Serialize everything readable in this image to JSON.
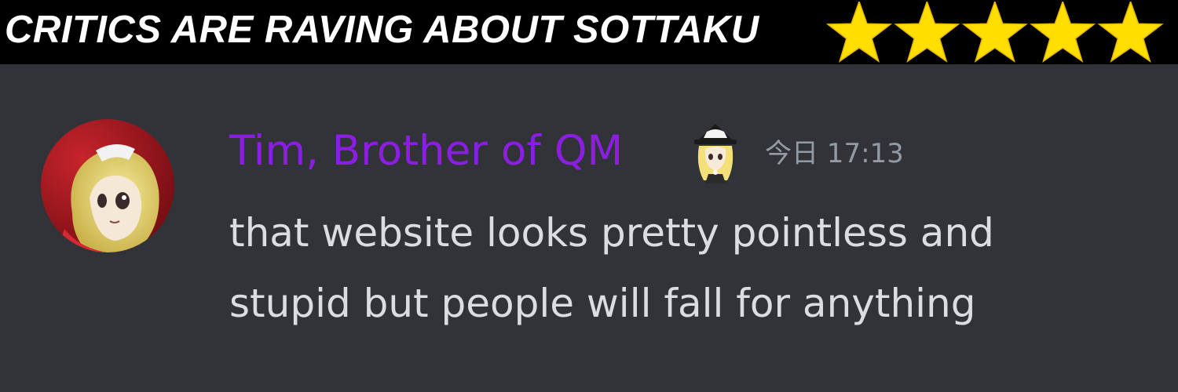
{
  "banner": {
    "headline": "CRITICS ARE RAVING ABOUT SOTTAKU",
    "rating": {
      "value": 5,
      "max": 5,
      "icon": "star-icon",
      "color": "#ffde00"
    }
  },
  "message": {
    "author": {
      "name": "Tim, Brother of QM",
      "name_color": "#8c1ee4",
      "avatar_icon": "user-avatar-icon",
      "role_icon": "role-badge-icon"
    },
    "timestamp": "今日 17:13",
    "lines": [
      "that website looks pretty pointless and",
      "stupid but people will fall for anything"
    ]
  },
  "colors": {
    "banner_background": "#000000",
    "chat_background": "#313338",
    "message_text": "#dbdee1",
    "timestamp_text": "#949ba4"
  }
}
